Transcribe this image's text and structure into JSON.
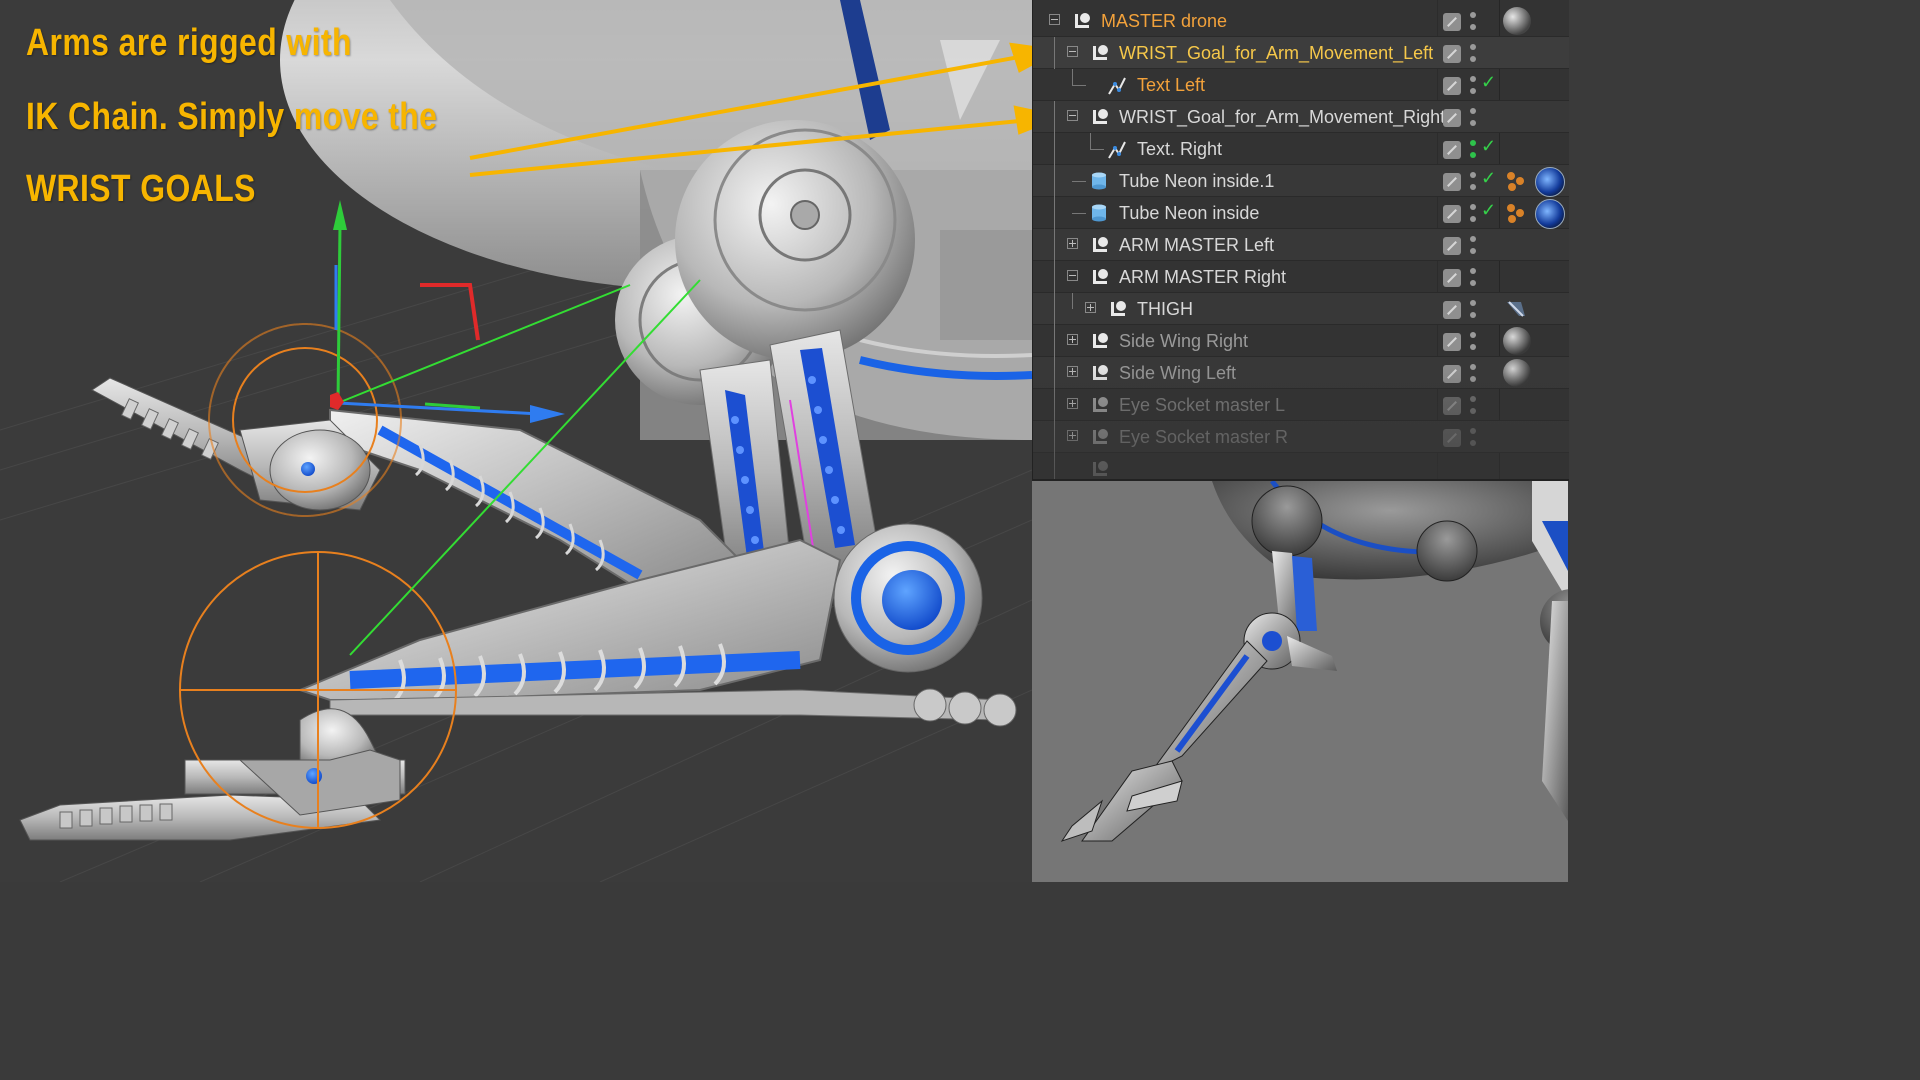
{
  "annotation": {
    "line1": "Arms are rigged with",
    "line2": "IK Chain.  Simply move the",
    "line3": "WRIST GOALS",
    "color": "#f7b500"
  },
  "outliner": {
    "rows": [
      {
        "name": "MASTER drone",
        "icon": "null-icon",
        "tag": "grey-sphere-material-icon"
      },
      {
        "name": "WRIST_Goal_for_Arm_Movement_Left",
        "icon": "null-icon"
      },
      {
        "name": "Text Left",
        "icon": "spline-icon",
        "check": "✓"
      },
      {
        "name": "WRIST_Goal_for_Arm_Movement_Right",
        "icon": "null-icon"
      },
      {
        "name": "Text. Right",
        "icon": "spline-icon",
        "check": "✓"
      },
      {
        "name": "Tube Neon inside.1",
        "icon": "tube-icon",
        "check": "✓",
        "tag": "blue-sphere-material-icon"
      },
      {
        "name": "Tube Neon inside",
        "icon": "tube-icon",
        "check": "✓",
        "tag": "blue-sphere-material-icon"
      },
      {
        "name": "ARM MASTER Left",
        "icon": "null-icon"
      },
      {
        "name": "ARM MASTER Right",
        "icon": "null-icon"
      },
      {
        "name": "THIGH",
        "icon": "null-icon",
        "tag": "ik-tag-icon"
      },
      {
        "name": "Side Wing Right",
        "icon": "null-icon",
        "tag": "grey-sphere-material-icon"
      },
      {
        "name": "Side Wing Left",
        "icon": "null-icon",
        "tag": "grey-sphere-material-icon"
      },
      {
        "name": "Eye Socket master L",
        "icon": "null-icon"
      },
      {
        "name": "Eye Socket master R",
        "icon": "null-icon"
      }
    ],
    "colors": {
      "orange": "#f3a23b",
      "yellow": "#f6c84a",
      "text": "#d8d8d8",
      "check": "#35d14a"
    }
  },
  "colors": {
    "arrow": "#f7b500",
    "ik_line": "#33dd33",
    "goal_circle": "#e8801e",
    "axis_y": "#2ecc3a",
    "axis_x": "#2f7cf0",
    "axis_z": "#e03030"
  }
}
